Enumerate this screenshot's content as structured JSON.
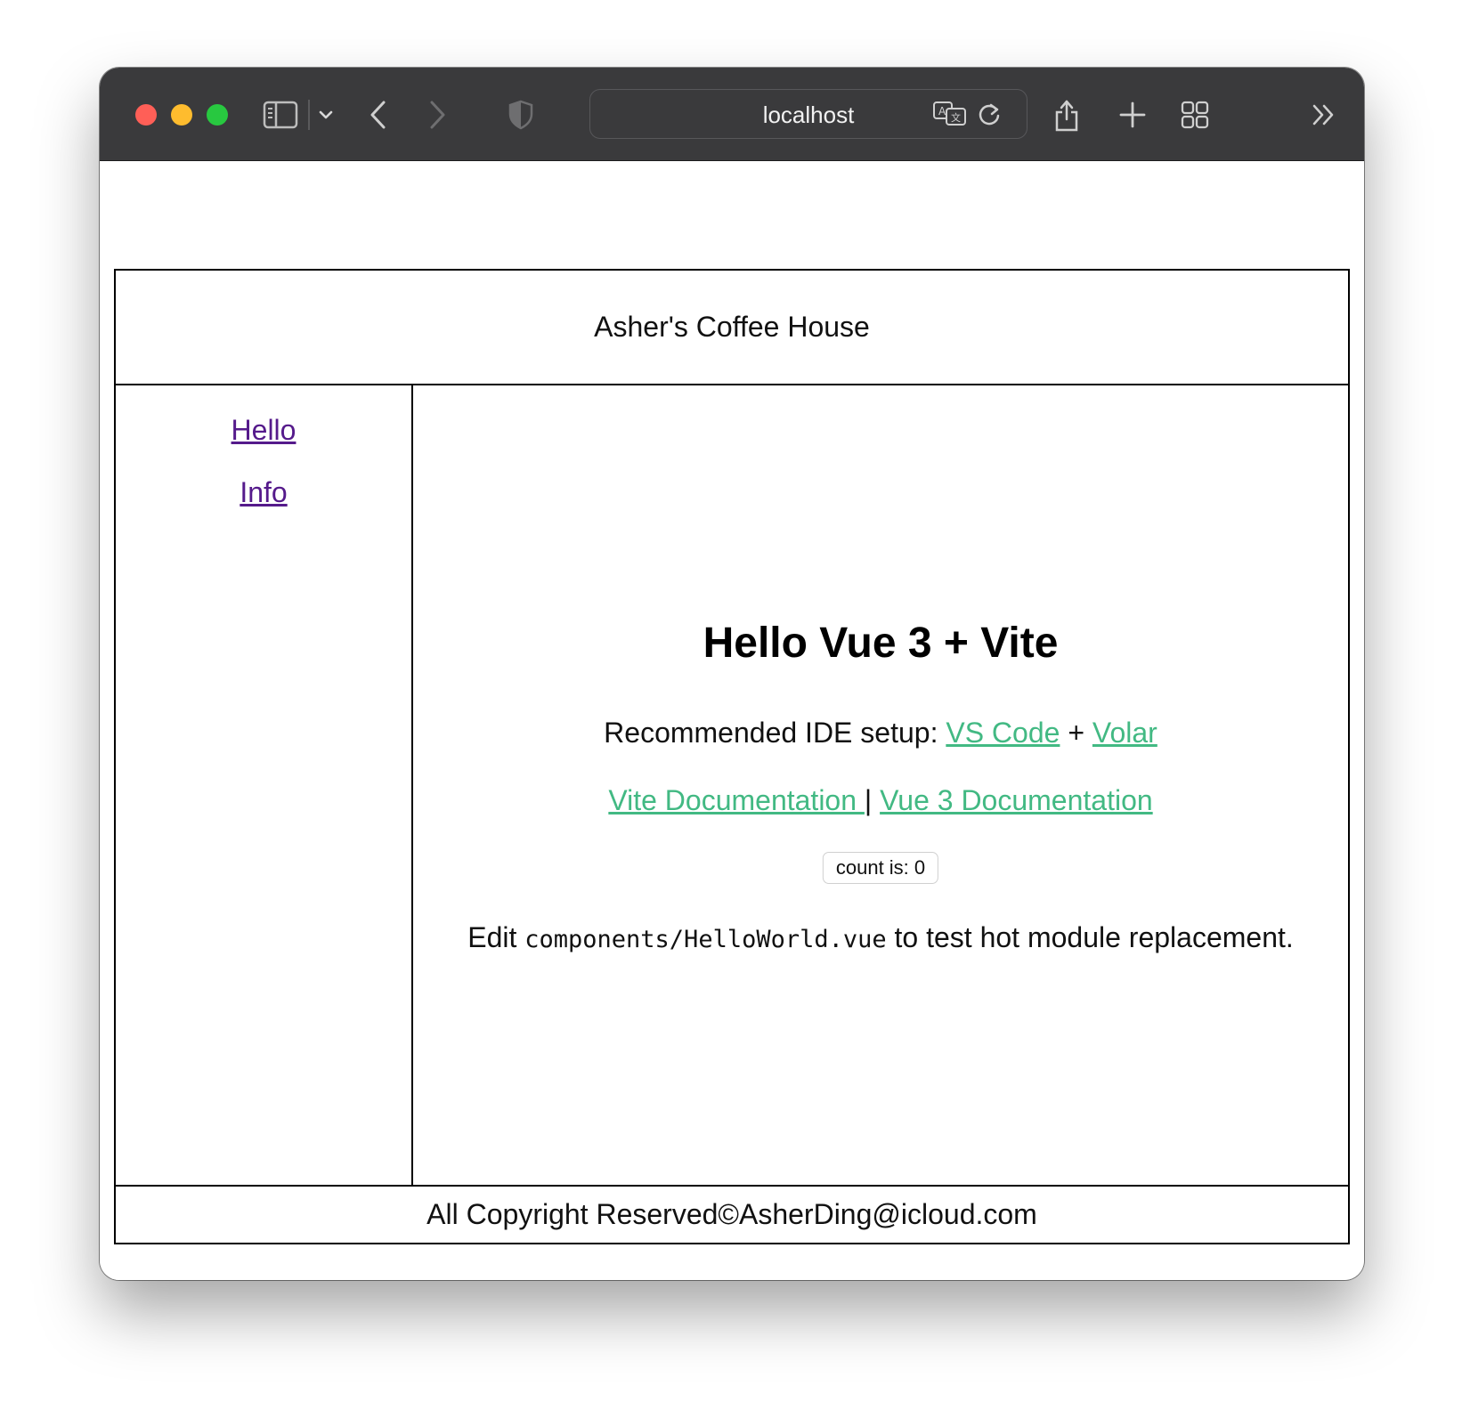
{
  "browser": {
    "url": "localhost",
    "icons": {
      "close": "close-icon",
      "minimize": "minimize-icon",
      "maximize": "maximize-icon",
      "sidebar": "sidebar-icon",
      "chevron": "chevron-down-icon",
      "back": "back-icon",
      "forward": "forward-icon",
      "shield": "shield-icon",
      "translate": "translate-icon",
      "reload": "reload-icon",
      "share": "share-icon",
      "new_tab": "plus-icon",
      "tab_overview": "tab-overview-icon",
      "more": "more-icon"
    },
    "colors": {
      "toolbar": "#3a3a3c",
      "red": "#ff5f57",
      "yellow": "#febc2e",
      "green": "#28c840"
    }
  },
  "page": {
    "header": {
      "title": "Asher's Coffee House"
    },
    "sidebar": {
      "links": [
        {
          "label": "Hello"
        },
        {
          "label": "Info"
        }
      ]
    },
    "main": {
      "heading": "Hello Vue 3 + Vite",
      "ide": {
        "prefix": "Recommended IDE setup: ",
        "link1": "VS Code",
        "separator": " + ",
        "link2": "Volar"
      },
      "docs": {
        "link1": "Vite Documentation ",
        "separator": "|",
        "link2": "Vue 3 Documentation"
      },
      "counter": {
        "label": "count is: 0"
      },
      "edit": {
        "prefix": "Edit ",
        "code": "components/HelloWorld.vue",
        "suffix": " to test hot module replacement."
      }
    },
    "footer": {
      "text": "All Copyright Reserved©AsherDing@icloud.com"
    },
    "colors": {
      "link_visited": "#551a8b",
      "link_green": "#42b983"
    }
  }
}
